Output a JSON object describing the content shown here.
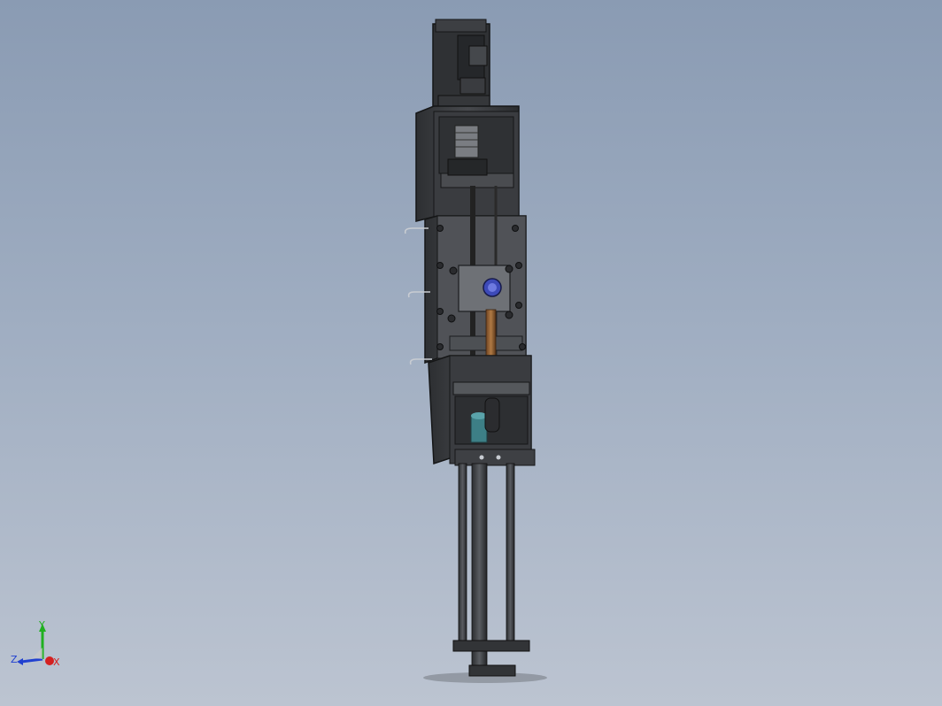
{
  "viewport": {
    "background_top": "#8a9bb3",
    "background_bottom": "#bcc4d1"
  },
  "triad": {
    "x_label": "X",
    "y_label": "Y",
    "z_label": "Z",
    "x_color": "#d42020",
    "y_color": "#20b020",
    "z_color": "#2040d0"
  },
  "model": {
    "body_color": "#3b3d40",
    "edge_color": "#151617",
    "hose_color": "#8a5a2e",
    "fitting_color": "#3d7f86",
    "sensor_color": "#3d4ab8"
  }
}
